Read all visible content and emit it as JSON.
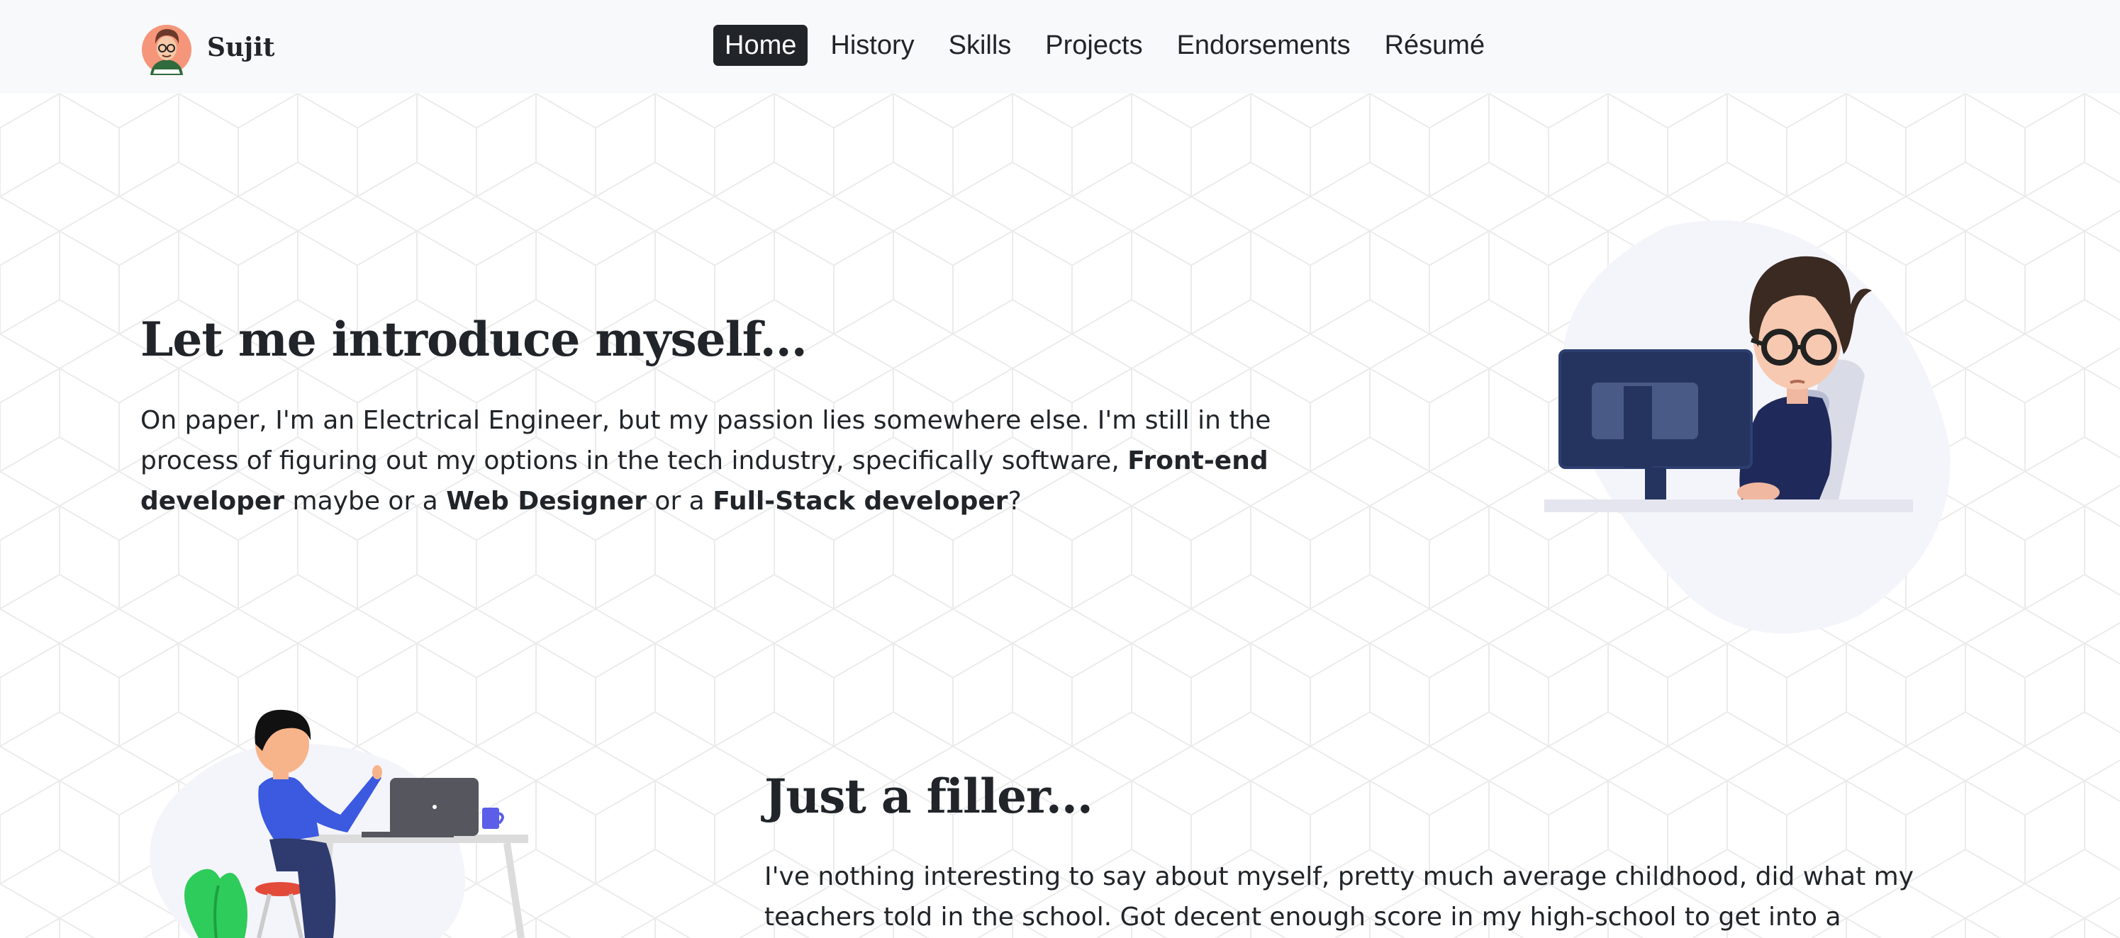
{
  "brand": {
    "name": "Sujit",
    "avatar_icon": "avatar-icon"
  },
  "nav": {
    "items": [
      {
        "label": "Home",
        "active": true
      },
      {
        "label": "History",
        "active": false
      },
      {
        "label": "Skills",
        "active": false
      },
      {
        "label": "Projects",
        "active": false
      },
      {
        "label": "Endorsements",
        "active": false
      },
      {
        "label": "Résumé",
        "active": false
      }
    ]
  },
  "intro": {
    "title": "Let me introduce myself...",
    "text_1": "On paper, I'm an Electrical Engineer, but my passion lies somewhere else. I'm still in the process of figuring out my options in the tech industry, specifically software, ",
    "bold_1": "Front-end developer",
    "text_2": " maybe or a ",
    "bold_2": "Web Designer",
    "text_3": " or a ",
    "bold_3": "Full-Stack developer",
    "text_4": "?",
    "illustration_icon": "developer-at-computer-illustration"
  },
  "filler": {
    "title": "Just a filler...",
    "text": "I've nothing interesting to say about myself, pretty much average childhood, did what my teachers told in the school. Got decent enough score in my high-school to get into a",
    "illustration_icon": "person-at-laptop-illustration"
  },
  "colors": {
    "navbar_bg": "#f8f9fa",
    "text": "#212529",
    "active_nav_bg": "#212529",
    "blob": "#f4f4fb"
  }
}
